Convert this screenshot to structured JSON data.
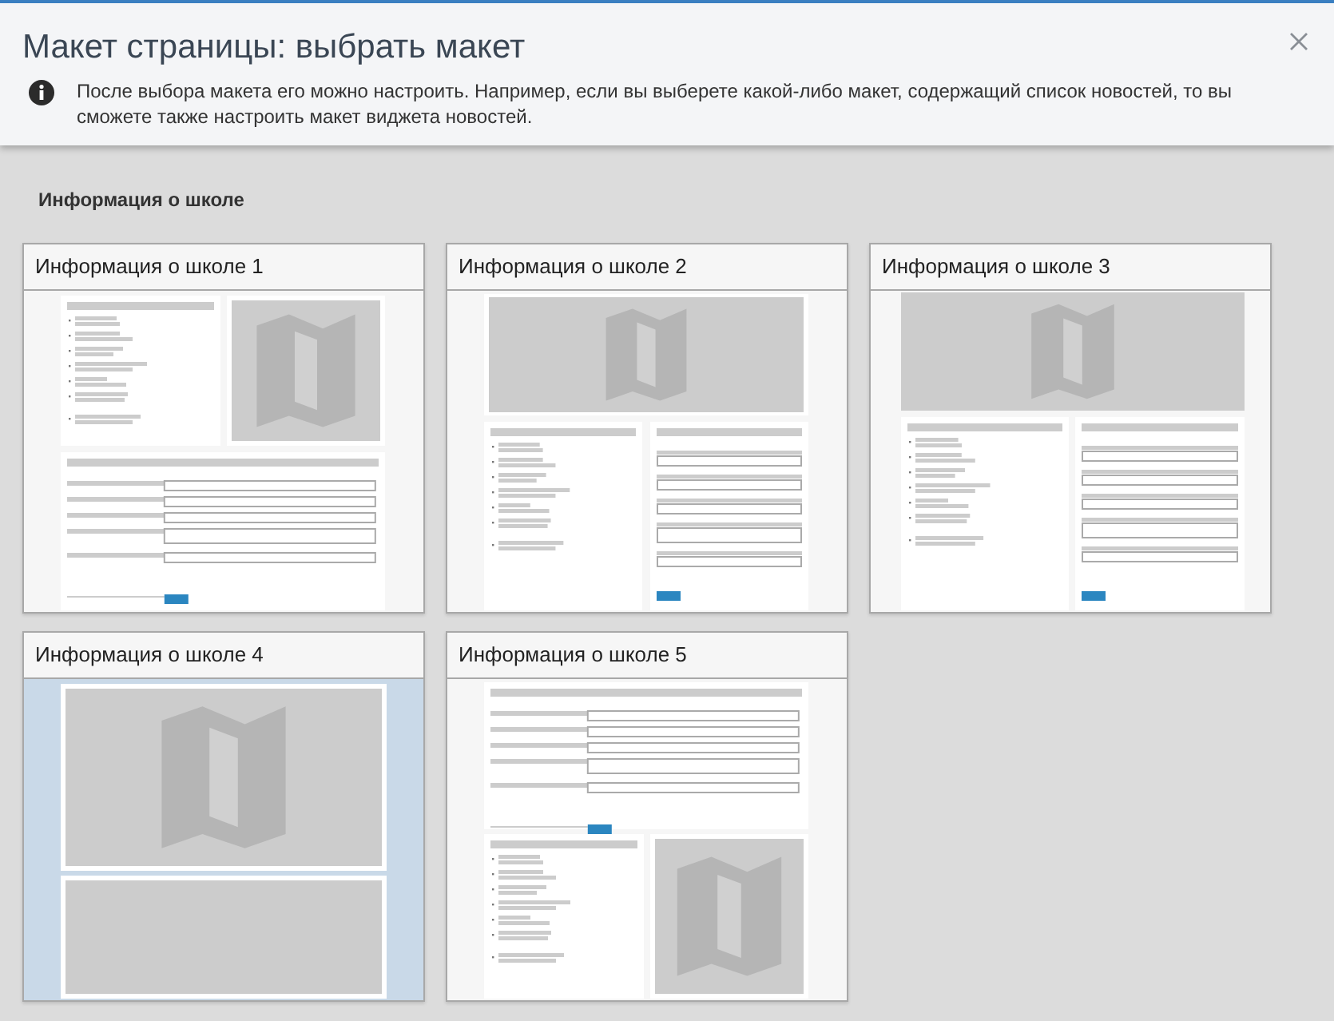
{
  "dialog": {
    "title": "Макет страницы: выбрать макет",
    "info": "После выбора макета его можно настроить. Например, если вы выберете какой-либо макет, содержащий список новостей, то вы сможете также настроить макет виджета новостей."
  },
  "section": {
    "title": "Информация о школе"
  },
  "layouts": [
    {
      "title": "Информация о школе 1",
      "selected": false,
      "kind": "list-map-form"
    },
    {
      "title": "Информация о школе 2",
      "selected": false,
      "kind": "map-list-form"
    },
    {
      "title": "Информация о школе 3",
      "selected": false,
      "kind": "wide-map-list-form"
    },
    {
      "title": "Информация о школе 4",
      "selected": true,
      "kind": "map-block"
    },
    {
      "title": "Информация о школе 5",
      "selected": false,
      "kind": "form-list-map"
    }
  ]
}
